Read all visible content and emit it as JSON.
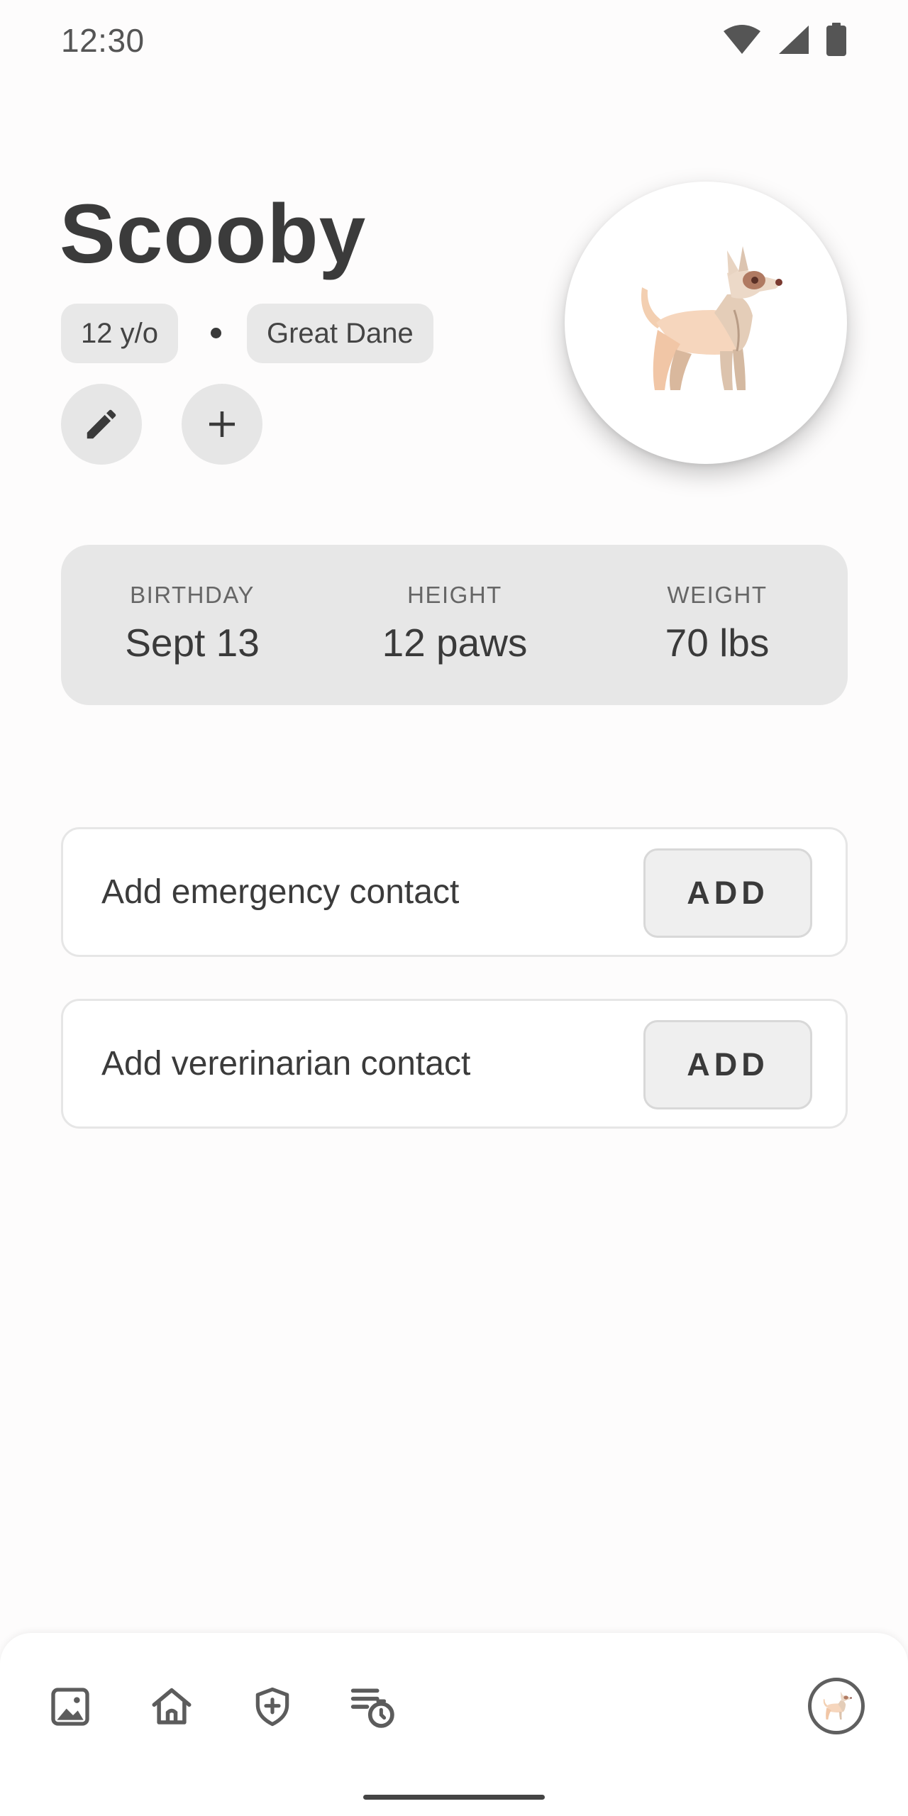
{
  "status_bar": {
    "time": "12:30",
    "icons": [
      "wifi-icon",
      "cellular-signal-icon",
      "battery-icon"
    ]
  },
  "pet": {
    "name": "Scooby",
    "age": "12 y/o",
    "breed": "Great Dane",
    "avatar_icon": "dog-illustration"
  },
  "header_actions": {
    "edit_icon": "pencil-icon",
    "add_icon": "plus-icon"
  },
  "stats": [
    {
      "label": "BIRTHDAY",
      "value": "Sept 13"
    },
    {
      "label": "HEIGHT",
      "value": "12 paws"
    },
    {
      "label": "WEIGHT",
      "value": "70 lbs"
    }
  ],
  "contacts": [
    {
      "text": "Add emergency contact",
      "button": "ADD"
    },
    {
      "text": "Add vererinarian contact",
      "button": "ADD"
    }
  ],
  "bottom_nav": {
    "items": [
      "gallery-icon",
      "home-icon",
      "shield-plus-icon",
      "timer-list-icon",
      "pet-profile-avatar"
    ]
  },
  "colors": {
    "background": "#fdfcfc",
    "chip": "#e8e8e8",
    "card": "#e7e7e7",
    "text": "#3a3a3a",
    "dog_main": "#f3cfb1",
    "dog_shade": "#d9c2ad"
  }
}
